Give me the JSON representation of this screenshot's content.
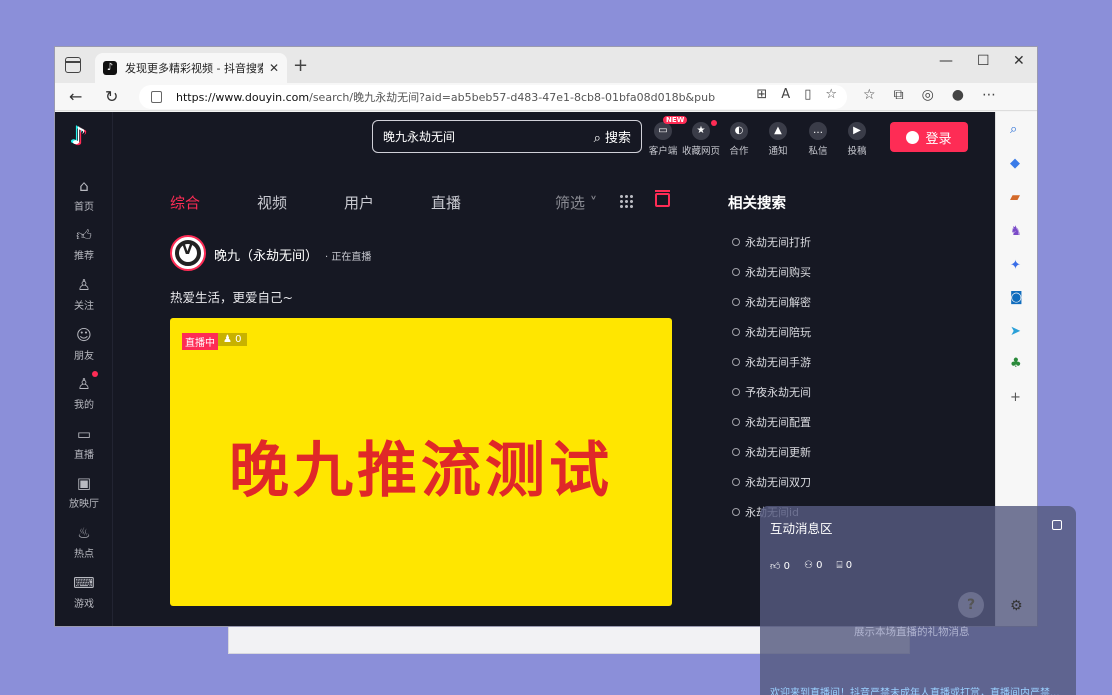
{
  "browser": {
    "tab_title": "发现更多精彩视频 - 抖音搜索",
    "tab_close": "✕",
    "new_tab": "+",
    "url_host": "https://www.douyin.com",
    "url_path": "/search/晚九永劫无间?aid=ab5beb57-d483-47e1-8cb8-01bfa08d018b&publish_ti..."
  },
  "nav": {
    "items": [
      {
        "label": "首页",
        "icon": "home-icon"
      },
      {
        "label": "推荐",
        "icon": "thumbs-up-icon"
      },
      {
        "label": "关注",
        "icon": "follow-icon"
      },
      {
        "label": "朋友",
        "icon": "friends-icon"
      },
      {
        "label": "我的",
        "icon": "user-icon"
      },
      {
        "label": "直播",
        "icon": "live-icon"
      },
      {
        "label": "放映厅",
        "icon": "tv-icon"
      },
      {
        "label": "热点",
        "icon": "fire-icon"
      },
      {
        "label": "游戏",
        "icon": "gamepad-icon"
      }
    ]
  },
  "header": {
    "search_query": "晚九永劫无间",
    "search_button": "搜索",
    "new_badge": "NEW",
    "icons": [
      {
        "label": "客户端"
      },
      {
        "label": "收藏网页"
      },
      {
        "label": "合作"
      },
      {
        "label": "通知"
      },
      {
        "label": "私信"
      },
      {
        "label": "投稿"
      }
    ],
    "login": "登录"
  },
  "tabs": {
    "items": [
      "综合",
      "视频",
      "用户",
      "直播"
    ],
    "filter": "筛选"
  },
  "result": {
    "username": "晚九（永劫无间）",
    "live_status": "· 正在直播",
    "bio": "热爱生活，更爱自己~",
    "live_badge": "直播中",
    "viewers": "0",
    "headline": "晚九推流测试"
  },
  "related": {
    "title": "相关搜索",
    "items": [
      "永劫无间打折",
      "永劫无间购买",
      "永劫无间解密",
      "永劫无间陪玩",
      "永劫无间手游",
      "予夜永劫无间",
      "永劫无间配置",
      "永劫无间更新",
      "永劫无间双刀",
      "永劫无间id"
    ]
  },
  "overlay": {
    "title": "互动消息区",
    "likes": "0",
    "follows": "0",
    "gifts": "0",
    "hint": "展示本场直播的礼物消息",
    "notice": "欢迎来到直播间！抖音严禁未成年人直播或打赏，直播间内严禁..."
  }
}
